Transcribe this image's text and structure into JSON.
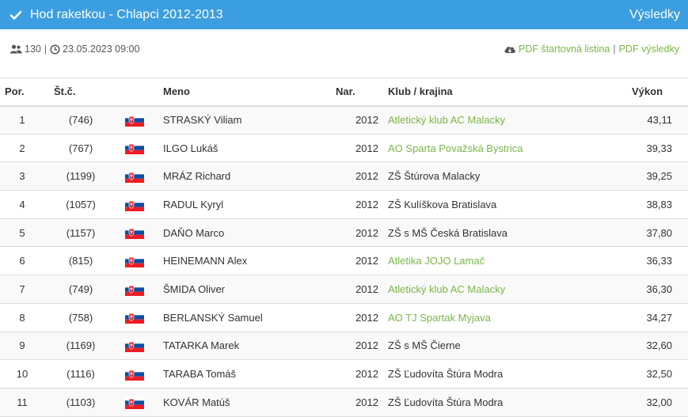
{
  "header": {
    "title": "Hod raketkou - Chlapci 2012-2013",
    "results_link": "Výsledky"
  },
  "info": {
    "count": "130",
    "datetime": "23.05.2023 09:00",
    "pdf_start": "PDF štartovná listina",
    "separator": "|",
    "pdf_results": "PDF výsledky"
  },
  "table": {
    "headers": {
      "por": "Por.",
      "stc": "Št.č.",
      "name": "Meno",
      "nar": "Nar.",
      "club": "Klub / krajina",
      "vykon": "Výkon"
    },
    "rows": [
      {
        "por": "1",
        "stc": "(746)",
        "name": "STRASKÝ Viliam",
        "nar": "2012",
        "club": "Atletický klub AC Malacky",
        "club_link": true,
        "vykon": "43,11"
      },
      {
        "por": "2",
        "stc": "(767)",
        "name": "ILGO Lukáš",
        "nar": "2012",
        "club": "AO Sparta Považská Bystrica",
        "club_link": true,
        "vykon": "39,33"
      },
      {
        "por": "3",
        "stc": "(1199)",
        "name": "MRÁZ Richard",
        "nar": "2012",
        "club": "ZŠ Štúrova Malacky",
        "club_link": false,
        "vykon": "39,25"
      },
      {
        "por": "4",
        "stc": "(1057)",
        "name": "RADUL Kyryl",
        "nar": "2012",
        "club": "ZŠ Kulíškova Bratislava",
        "club_link": false,
        "vykon": "38,83"
      },
      {
        "por": "5",
        "stc": "(1157)",
        "name": "DAŇO Marco",
        "nar": "2012",
        "club": "ZŠ s MŠ Česká Bratislava",
        "club_link": false,
        "vykon": "37,80"
      },
      {
        "por": "6",
        "stc": "(815)",
        "name": "HEINEMANN Alex",
        "nar": "2012",
        "club": "Atletika JOJO Lamač",
        "club_link": true,
        "vykon": "36,33"
      },
      {
        "por": "7",
        "stc": "(749)",
        "name": "ŠMIDA Oliver",
        "nar": "2012",
        "club": "Atletický klub AC Malacky",
        "club_link": true,
        "vykon": "36,30"
      },
      {
        "por": "8",
        "stc": "(758)",
        "name": "BERLANSKÝ Samuel",
        "nar": "2012",
        "club": "AO TJ Spartak Myjava",
        "club_link": true,
        "vykon": "34,27"
      },
      {
        "por": "9",
        "stc": "(1169)",
        "name": "TATARKA Marek",
        "nar": "2012",
        "club": "ZŠ s MŠ Čierne",
        "club_link": false,
        "vykon": "32,60"
      },
      {
        "por": "10",
        "stc": "(1116)",
        "name": "TARABA Tomáš",
        "nar": "2012",
        "club": "ZŠ Ľudovíta Štúra Modra",
        "club_link": false,
        "vykon": "32,50"
      },
      {
        "por": "11",
        "stc": "(1103)",
        "name": "KOVÁR Matúš",
        "nar": "2012",
        "club": "ZŠ Ľudovíta Štúra Modra",
        "club_link": false,
        "vykon": "32,00"
      }
    ]
  },
  "icons": {
    "check": "check-icon",
    "users": "users-icon",
    "clock": "clock-icon",
    "cloud_download": "cloud-download-icon",
    "flag": "slovakia-flag-icon"
  },
  "colors": {
    "header_bg": "#3b9ee0",
    "link_green": "#7ab648",
    "row_stripe": "#f9f9f9"
  }
}
